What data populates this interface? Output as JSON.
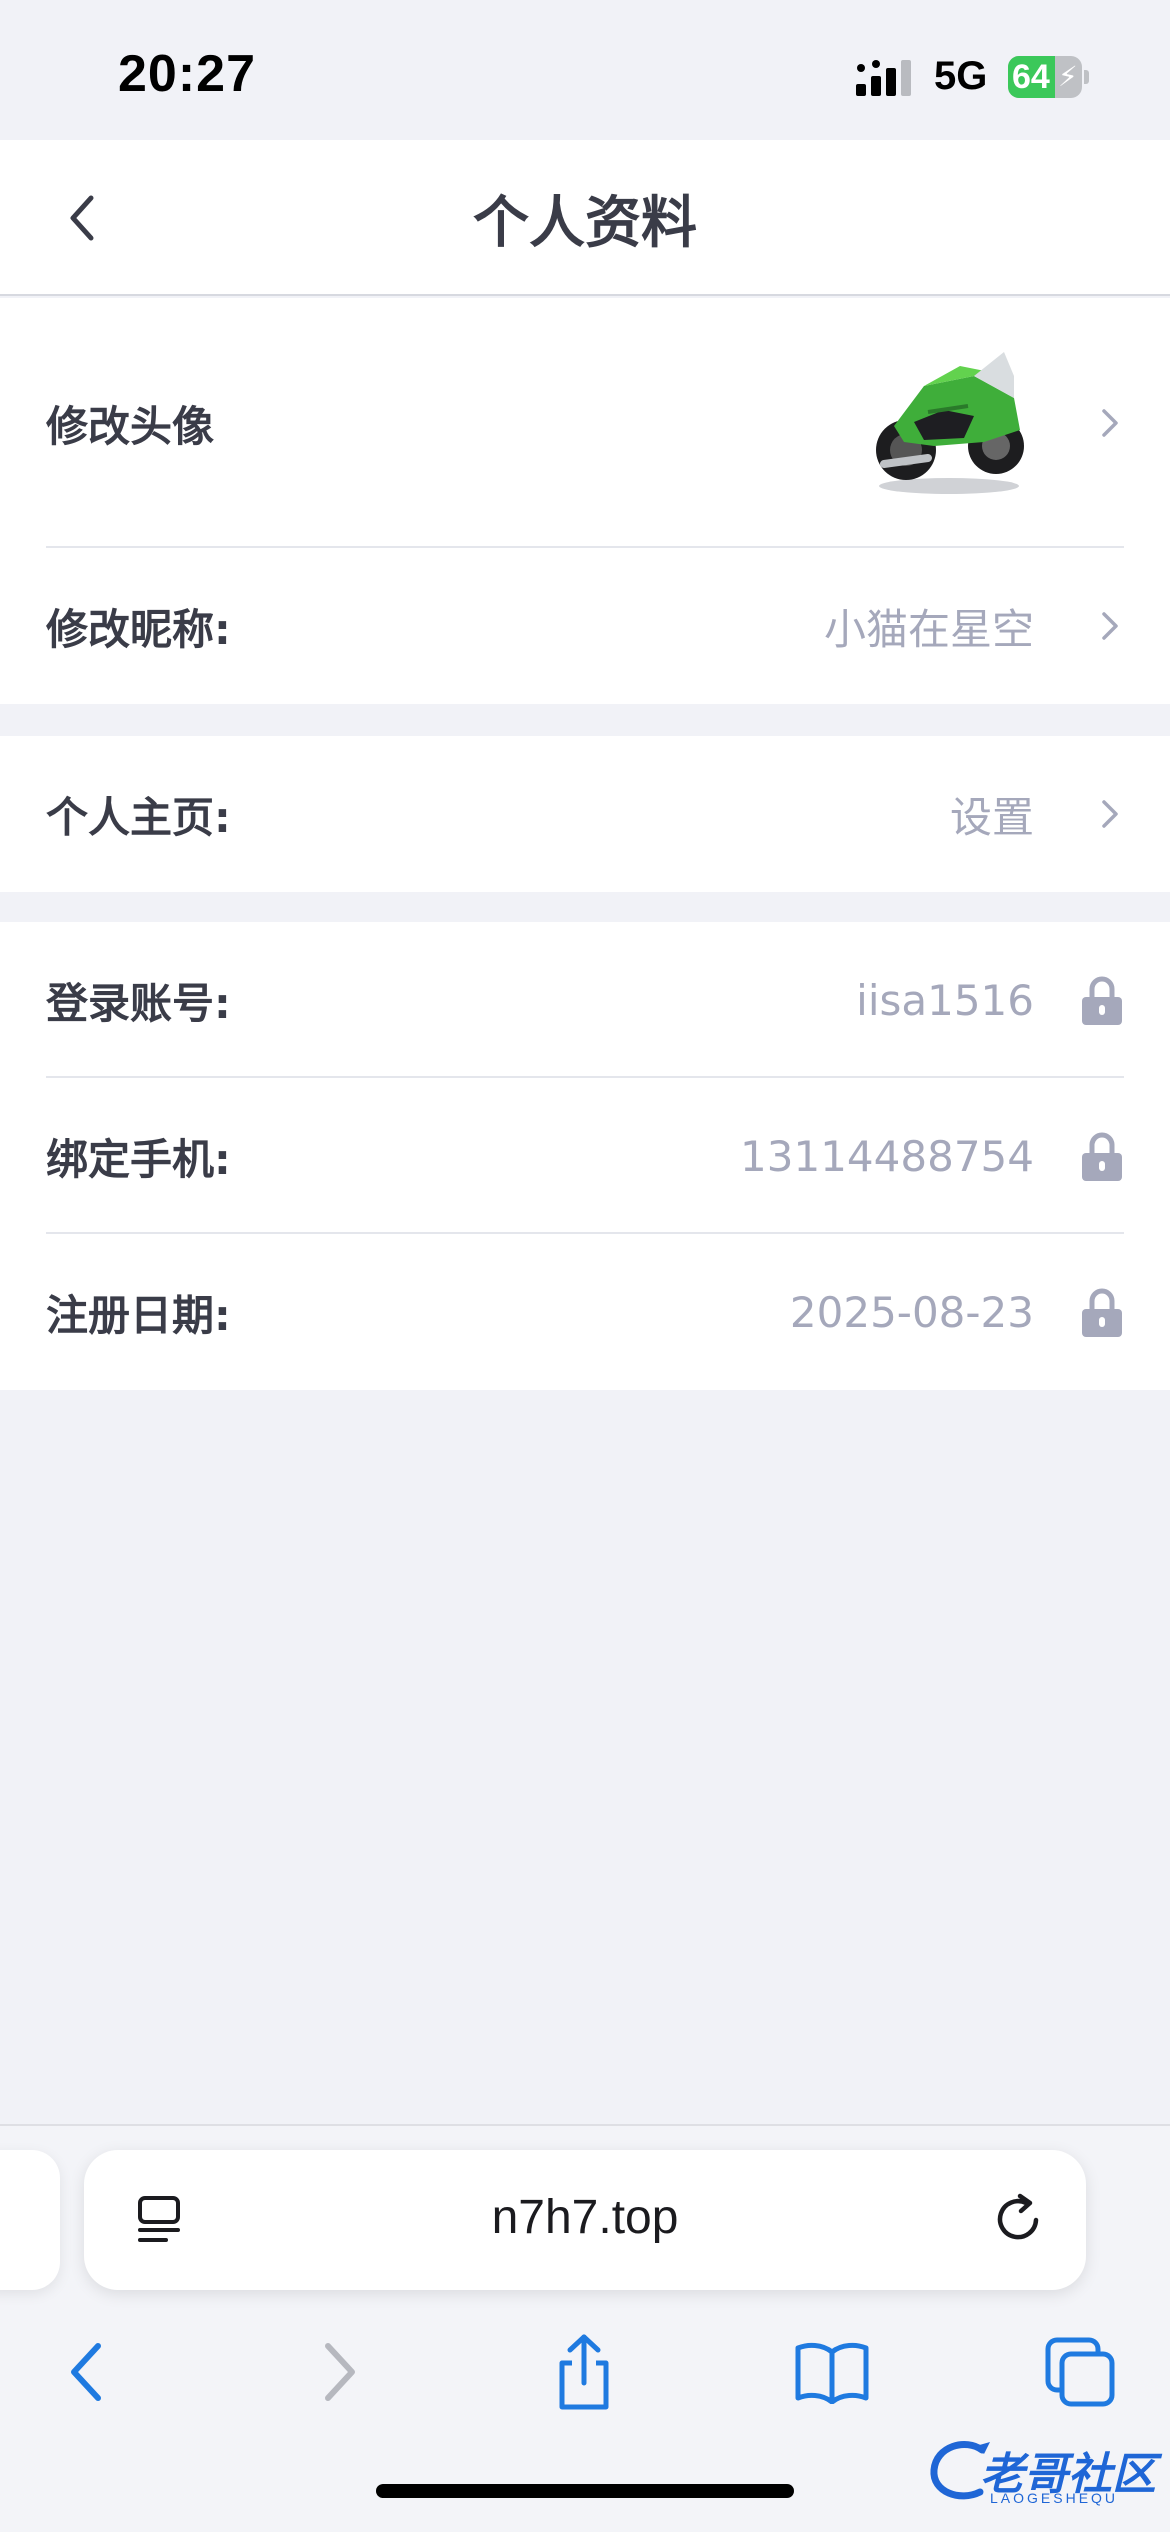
{
  "status_bar": {
    "time": "20:27",
    "network": "5G",
    "battery_percent": "64",
    "battery_level": 0.64
  },
  "header": {
    "title": "个人资料"
  },
  "profile": {
    "avatar": {
      "label": "修改头像",
      "image": "green-motorcycle"
    },
    "nickname": {
      "label": "修改昵称:",
      "value": "小猫在星空"
    },
    "homepage": {
      "label": "个人主页:",
      "value": "设置"
    },
    "account": {
      "label": "登录账号:",
      "value": "iisa1516"
    },
    "phone": {
      "label": "绑定手机:",
      "value": "13114488754"
    },
    "register_date": {
      "label": "注册日期:",
      "value": "2025-08-23"
    }
  },
  "browser": {
    "url": "n7h7.top"
  },
  "watermark": {
    "text": "老哥社区",
    "sub": "LAOGESHEQU"
  },
  "colors": {
    "accent": "#1f7ae0",
    "muted": "#a5a8bb",
    "label": "#3a3c48",
    "battery": "#3bc85a"
  }
}
